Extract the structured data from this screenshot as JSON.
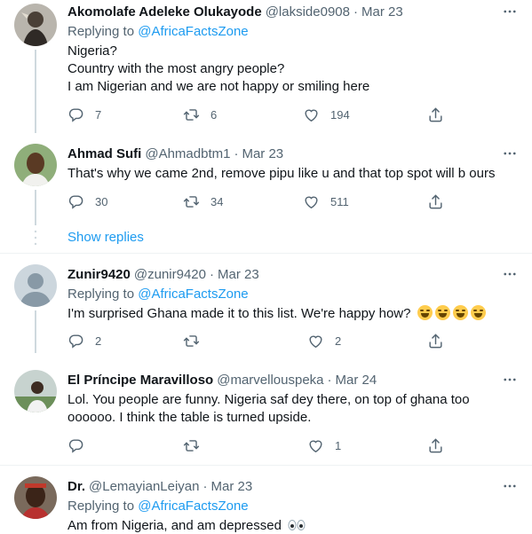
{
  "tweets": [
    {
      "name": "Akomolafe Adeleke Olukayode",
      "handle": "@lakside0908",
      "date": "Mar 23",
      "replying_prefix": "Replying to ",
      "replying_to": "@AfricaFactsZone",
      "text_lines": [
        "Nigeria?",
        "Country with the most angry people?",
        "I am Nigerian and we are not happy or smiling here"
      ],
      "replies": "7",
      "retweets": "6",
      "likes": "194"
    },
    {
      "name": "Ahmad Sufi",
      "handle": "@Ahmadbtm1",
      "date": "Mar 23",
      "text_lines": [
        "That's why we came 2nd, remove pipu like u and that top spot will b ours"
      ],
      "replies": "30",
      "retweets": "34",
      "likes": "511"
    },
    {
      "name": "Zunir9420",
      "handle": "@zunir9420",
      "date": "Mar 23",
      "replying_prefix": "Replying to ",
      "replying_to": "@AfricaFactsZone",
      "text_lines": [
        "I'm surprised Ghana made it to this list. We're happy how?"
      ],
      "replies": "2",
      "retweets": "",
      "likes": "2"
    },
    {
      "name": "El Príncipe Maravilloso",
      "handle": "@marvellouspeka",
      "date": "Mar 24",
      "text_lines": [
        "Lol. You people are funny. Nigeria saf dey there, on top of ghana too",
        "oooooo. I think the table is turned upside."
      ],
      "replies": "",
      "retweets": "",
      "likes": "1"
    },
    {
      "name": "Dr.",
      "handle": "@LemayianLeiyan",
      "date": "Mar 23",
      "replying_prefix": "Replying to ",
      "replying_to": "@AfricaFactsZone",
      "text_lines": [
        "Am from Nigeria, and am depressed"
      ]
    }
  ],
  "show_replies_label": "Show replies",
  "icons": {
    "reply": "reply-icon",
    "retweet": "retweet-icon",
    "like": "heart-icon",
    "share": "share-icon",
    "more": "more-icon"
  },
  "colors": {
    "link": "#1d9bf0",
    "secondary_text": "#536471",
    "divider": "#eff3f4"
  }
}
